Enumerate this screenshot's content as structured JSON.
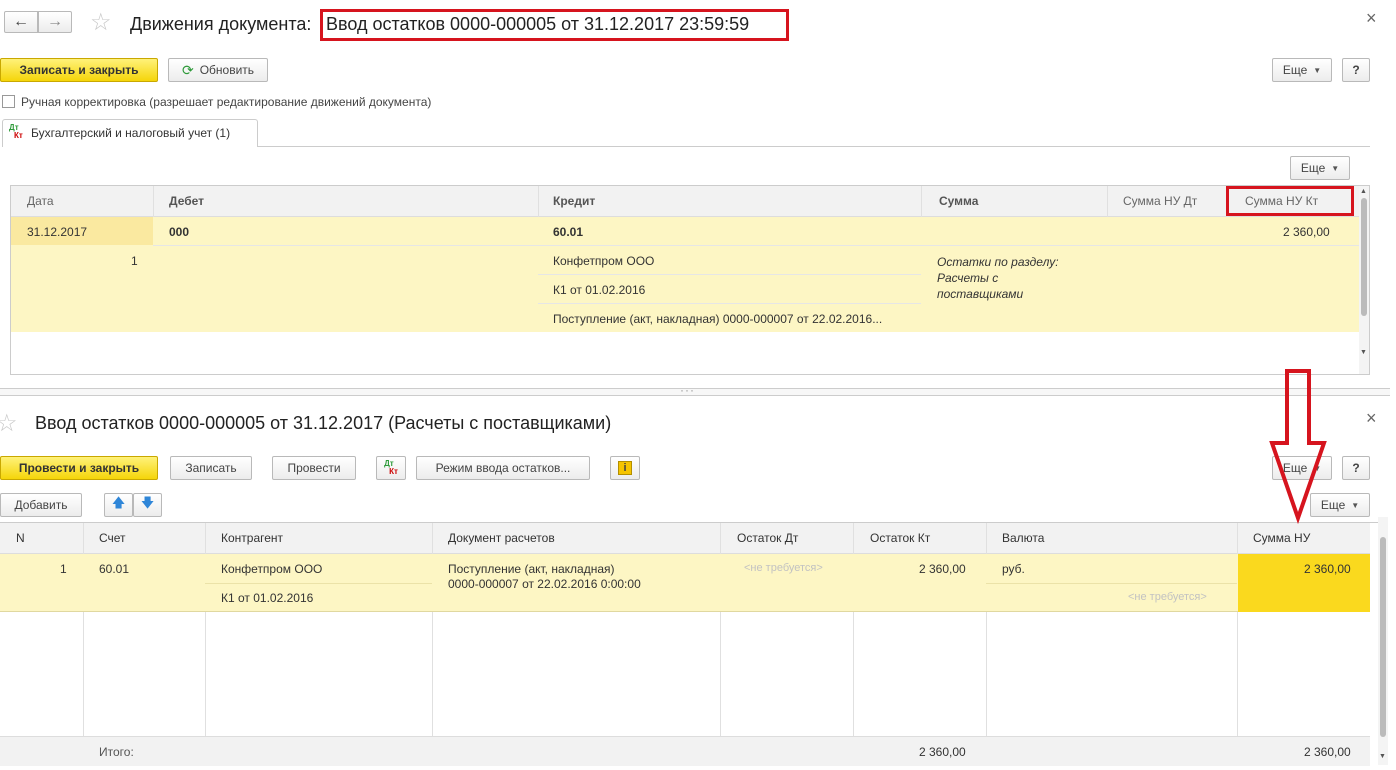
{
  "top_window": {
    "title_prefix": "Движения документа:",
    "title_doc": "Ввод остатков 0000-000005 от 31.12.2017 23:59:59",
    "close": "×",
    "save_close": "Записать и закрыть",
    "refresh": "Обновить",
    "more": "Еще",
    "help": "?",
    "manual_checkbox_label": "Ручная корректировка (разрешает редактирование движений документа)",
    "tab_label": "Бухгалтерский и налоговый учет (1)",
    "table_more": "Еще",
    "columns": [
      "Дата",
      "Дебет",
      "Кредит",
      "Сумма",
      "Сумма НУ Дт",
      "Сумма НУ Кт"
    ],
    "row": {
      "date": "31.12.2017",
      "num": "1",
      "debit": "000",
      "credit": "60.01",
      "credit_sub1": "Конфетпром ООО",
      "credit_sub2": "К1 от 01.02.2016",
      "credit_sub3": "Поступление (акт, накладная) 0000-000007 от 22.02.2016...",
      "sum_note": "Остатки по разделу: Расчеты с поставщиками",
      "sum_nu_kt": "2 360,00"
    }
  },
  "bottom_window": {
    "title": "Ввод остатков 0000-000005 от 31.12.2017 (Расчеты с поставщиками)",
    "close": "×",
    "post_close": "Провести и закрыть",
    "save": "Записать",
    "post": "Провести",
    "dtkt_icon": "ДтКт",
    "mode": "Режим ввода остатков...",
    "info_icon": "i",
    "more": "Еще",
    "help": "?",
    "add": "Добавить",
    "table_more": "Еще",
    "columns": [
      "N",
      "Счет",
      "Контрагент",
      "Документ расчетов",
      "Остаток Дт",
      "Остаток Кт",
      "Валюта",
      "Сумма НУ"
    ],
    "row": {
      "n": "1",
      "account": "60.01",
      "contractor": "Конфетпром ООО",
      "contract": "К1 от 01.02.2016",
      "doc_line1": "Поступление (акт, накладная)",
      "doc_line2": "0000-000007 от 22.02.2016 0:00:00",
      "rest_dt": "<не требуется>",
      "rest_kt": "2 360,00",
      "currency": "руб.",
      "currency_sub": "<не требуется>",
      "sum_nu": "2 360,00"
    },
    "footer": {
      "label": "Итого:",
      "rest_kt_total": "2 360,00",
      "sum_nu_total": "2 360,00"
    }
  },
  "colors": {
    "highlight_red": "#d6141e",
    "row_yellow": "#fdf6c4",
    "selected_cell": "#fad91e"
  }
}
